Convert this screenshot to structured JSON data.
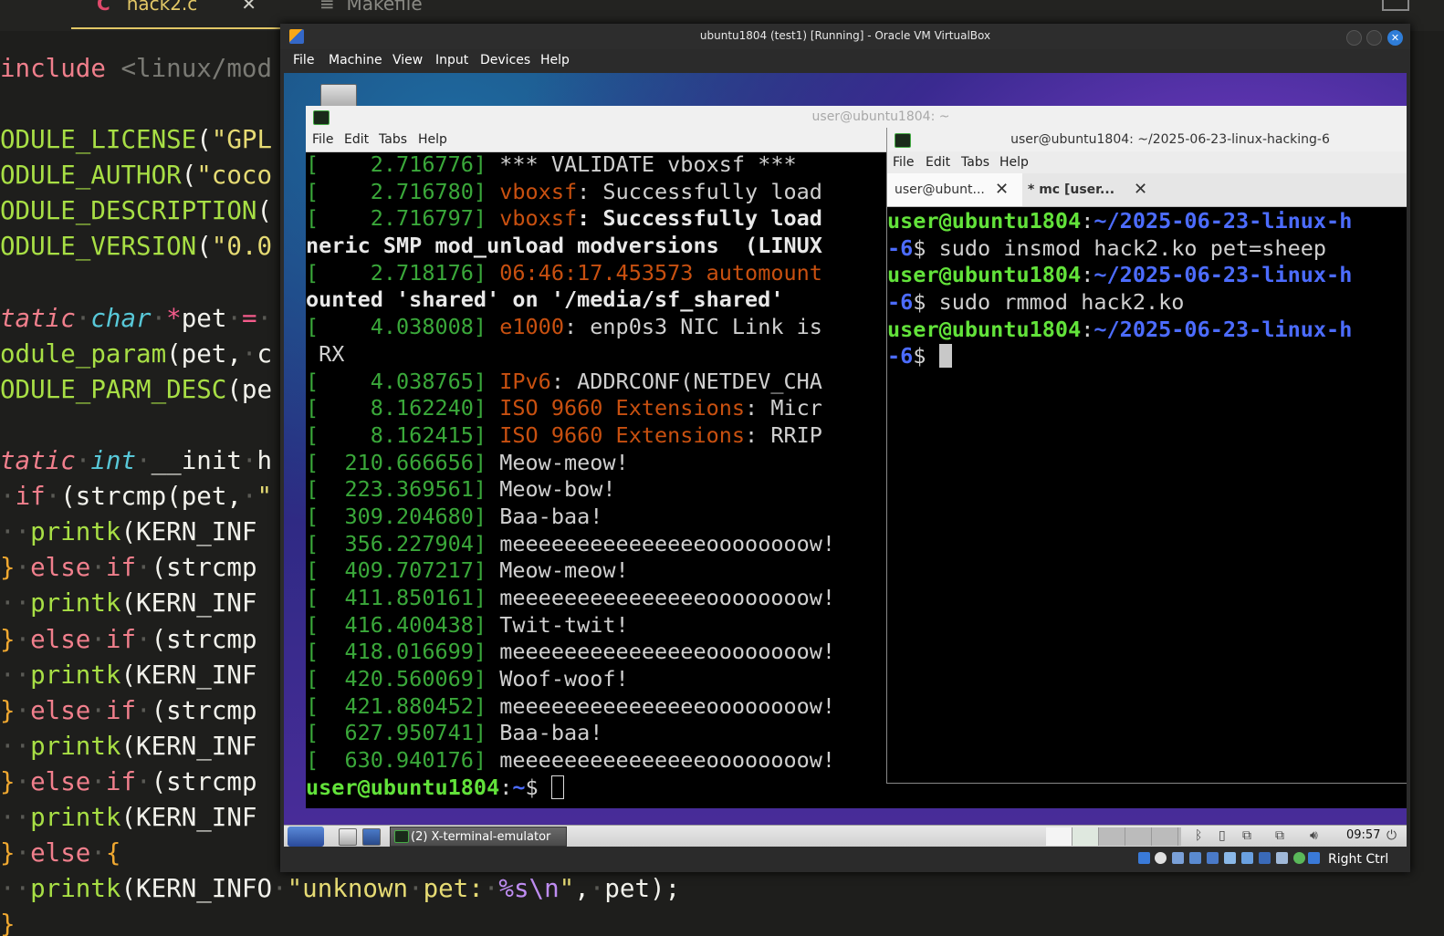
{
  "editor": {
    "tabs": [
      {
        "label": "hack2.c",
        "icon": "c-file-icon"
      },
      {
        "label": "Makefile",
        "icon": "menu-lines-icon"
      }
    ],
    "lines": [
      [
        {
          "c": "k",
          "t": "include"
        },
        {
          "c": "dim",
          "t": " <linux/mod"
        }
      ],
      [],
      [
        {
          "c": "mac",
          "t": "ODULE_LICENSE"
        },
        {
          "c": "vt",
          "t": "("
        },
        {
          "c": "st",
          "t": "\"GPL"
        }
      ],
      [
        {
          "c": "mac",
          "t": "ODULE_AUTHOR"
        },
        {
          "c": "vt",
          "t": "("
        },
        {
          "c": "st",
          "t": "\"coco"
        }
      ],
      [
        {
          "c": "mac",
          "t": "ODULE_DESCRIPTION"
        },
        {
          "c": "vt",
          "t": "("
        }
      ],
      [
        {
          "c": "mac",
          "t": "ODULE_VERSION"
        },
        {
          "c": "vt",
          "t": "("
        },
        {
          "c": "st",
          "t": "\"0.0"
        }
      ],
      [],
      [
        {
          "c": "ks",
          "t": "tatic"
        },
        {
          "c": "dt",
          "t": "·"
        },
        {
          "c": "ty",
          "t": "char"
        },
        {
          "c": "dt",
          "t": "·"
        },
        {
          "c": "op",
          "t": "*"
        },
        {
          "c": "vt",
          "t": "pet"
        },
        {
          "c": "dt",
          "t": "·"
        },
        {
          "c": "op",
          "t": "="
        },
        {
          "c": "dt",
          "t": "·"
        }
      ],
      [
        {
          "c": "mac",
          "t": "odule_param"
        },
        {
          "c": "vt",
          "t": "(pet,"
        },
        {
          "c": "dt",
          "t": "·"
        },
        {
          "c": "vt",
          "t": "c"
        }
      ],
      [
        {
          "c": "mac",
          "t": "ODULE_PARM_DESC"
        },
        {
          "c": "vt",
          "t": "(pe"
        }
      ],
      [],
      [
        {
          "c": "ks",
          "t": "tatic"
        },
        {
          "c": "dt",
          "t": "·"
        },
        {
          "c": "ty",
          "t": "int"
        },
        {
          "c": "dt",
          "t": "·"
        },
        {
          "c": "vt",
          "t": "__init"
        },
        {
          "c": "dt",
          "t": "·"
        },
        {
          "c": "vt",
          "t": "h"
        }
      ],
      [
        {
          "c": "dt",
          "t": "·"
        },
        {
          "c": "k",
          "t": "if"
        },
        {
          "c": "dt",
          "t": "·"
        },
        {
          "c": "vt",
          "t": "(strcmp(pet,"
        },
        {
          "c": "dt",
          "t": "·"
        },
        {
          "c": "st",
          "t": "\""
        }
      ],
      [
        {
          "c": "dt",
          "t": "··"
        },
        {
          "c": "mac",
          "t": "printk"
        },
        {
          "c": "vt",
          "t": "(KERN_INF"
        }
      ],
      [
        {
          "c": "br",
          "t": "}"
        },
        {
          "c": "dt",
          "t": "·"
        },
        {
          "c": "k",
          "t": "else"
        },
        {
          "c": "dt",
          "t": "·"
        },
        {
          "c": "k",
          "t": "if"
        },
        {
          "c": "dt",
          "t": "·"
        },
        {
          "c": "vt",
          "t": "(strcmp"
        }
      ],
      [
        {
          "c": "dt",
          "t": "··"
        },
        {
          "c": "mac",
          "t": "printk"
        },
        {
          "c": "vt",
          "t": "(KERN_INF"
        }
      ],
      [
        {
          "c": "br",
          "t": "}"
        },
        {
          "c": "dt",
          "t": "·"
        },
        {
          "c": "k",
          "t": "else"
        },
        {
          "c": "dt",
          "t": "·"
        },
        {
          "c": "k",
          "t": "if"
        },
        {
          "c": "dt",
          "t": "·"
        },
        {
          "c": "vt",
          "t": "(strcmp"
        }
      ],
      [
        {
          "c": "dt",
          "t": "··"
        },
        {
          "c": "mac",
          "t": "printk"
        },
        {
          "c": "vt",
          "t": "(KERN_INF"
        }
      ],
      [
        {
          "c": "br",
          "t": "}"
        },
        {
          "c": "dt",
          "t": "·"
        },
        {
          "c": "k",
          "t": "else"
        },
        {
          "c": "dt",
          "t": "·"
        },
        {
          "c": "k",
          "t": "if"
        },
        {
          "c": "dt",
          "t": "·"
        },
        {
          "c": "vt",
          "t": "(strcmp"
        }
      ],
      [
        {
          "c": "dt",
          "t": "··"
        },
        {
          "c": "mac",
          "t": "printk"
        },
        {
          "c": "vt",
          "t": "(KERN_INF"
        }
      ],
      [
        {
          "c": "br",
          "t": "}"
        },
        {
          "c": "dt",
          "t": "·"
        },
        {
          "c": "k",
          "t": "else"
        },
        {
          "c": "dt",
          "t": "·"
        },
        {
          "c": "k",
          "t": "if"
        },
        {
          "c": "dt",
          "t": "·"
        },
        {
          "c": "vt",
          "t": "(strcmp"
        }
      ],
      [
        {
          "c": "dt",
          "t": "··"
        },
        {
          "c": "mac",
          "t": "printk"
        },
        {
          "c": "vt",
          "t": "(KERN_INF"
        }
      ],
      [
        {
          "c": "br",
          "t": "}"
        },
        {
          "c": "dt",
          "t": "·"
        },
        {
          "c": "k",
          "t": "else"
        },
        {
          "c": "dt",
          "t": "·"
        },
        {
          "c": "br",
          "t": "{"
        }
      ],
      [
        {
          "c": "dt",
          "t": "··"
        },
        {
          "c": "mac",
          "t": "printk"
        },
        {
          "c": "vt",
          "t": "(KERN_INFO"
        },
        {
          "c": "dt",
          "t": "·"
        },
        {
          "c": "st",
          "t": "\"unknown"
        },
        {
          "c": "dt",
          "t": "·"
        },
        {
          "c": "st",
          "t": "pet:"
        },
        {
          "c": "dt",
          "t": "·"
        },
        {
          "c": "sp",
          "t": "%s\\n"
        },
        {
          "c": "st",
          "t": "\""
        },
        {
          "c": "vt",
          "t": ","
        },
        {
          "c": "dt",
          "t": "·"
        },
        {
          "c": "vt",
          "t": "pet);"
        }
      ],
      [
        {
          "c": "br",
          "t": "}"
        }
      ]
    ]
  },
  "vbox": {
    "title": "ubuntu1804 (test1) [Running] - Oracle VM VirtualBox",
    "menu": [
      "File",
      "Machine",
      "View",
      "Input",
      "Devices",
      "Help"
    ],
    "host_key": "Right Ctrl"
  },
  "term1": {
    "title": "user@ubuntu1804: ~",
    "menu": [
      "File",
      "Edit",
      "Tabs",
      "Help"
    ],
    "lines": [
      [
        {
          "c": "g",
          "t": "[    2.716776]"
        },
        {
          "c": "",
          "t": " *** VALIDATE vboxsf ***"
        }
      ],
      [
        {
          "c": "g",
          "t": "[    2.716780]"
        },
        {
          "c": "o",
          "t": " vboxsf"
        },
        {
          "c": "",
          "t": ": Successfully load"
        }
      ],
      [
        {
          "c": "g",
          "t": "[    2.716797]"
        },
        {
          "c": "o",
          "t": " vboxsf"
        },
        {
          "c": "b",
          "t": ": Successfully load"
        }
      ],
      [
        {
          "c": "b",
          "t": "neric SMP mod_unload modversions  (LINUX"
        }
      ],
      [
        {
          "c": "g",
          "t": "[    2.718176]"
        },
        {
          "c": "o",
          "t": " 06:46:17.453573 automount"
        }
      ],
      [
        {
          "c": "b",
          "t": "ounted 'shared' on '/media/sf_shared'"
        }
      ],
      [
        {
          "c": "g",
          "t": "[    4.038008]"
        },
        {
          "c": "o",
          "t": " e1000"
        },
        {
          "c": "",
          "t": ": enp0s3 NIC Link is"
        }
      ],
      [
        {
          "c": "",
          "t": " RX"
        }
      ],
      [
        {
          "c": "g",
          "t": "[    4.038765]"
        },
        {
          "c": "o",
          "t": " IPv6"
        },
        {
          "c": "",
          "t": ": ADDRCONF(NETDEV_CHA"
        }
      ],
      [
        {
          "c": "g",
          "t": "[    8.162240]"
        },
        {
          "c": "o",
          "t": " ISO 9660 Extensions"
        },
        {
          "c": "",
          "t": ": Micr"
        }
      ],
      [
        {
          "c": "g",
          "t": "[    8.162415]"
        },
        {
          "c": "o",
          "t": " ISO 9660 Extensions"
        },
        {
          "c": "",
          "t": ": RRIP"
        }
      ],
      [
        {
          "c": "g",
          "t": "[  210.666656]"
        },
        {
          "c": "",
          "t": " Meow-meow!"
        }
      ],
      [
        {
          "c": "g",
          "t": "[  223.369561]"
        },
        {
          "c": "",
          "t": " Meow-bow!"
        }
      ],
      [
        {
          "c": "g",
          "t": "[  309.204680]"
        },
        {
          "c": "",
          "t": " Baa-baa!"
        }
      ],
      [
        {
          "c": "g",
          "t": "[  356.227904]"
        },
        {
          "c": "",
          "t": " meeeeeeeeeeeeeeeoooooooow!"
        }
      ],
      [
        {
          "c": "g",
          "t": "[  409.707217]"
        },
        {
          "c": "",
          "t": " Meow-meow!"
        }
      ],
      [
        {
          "c": "g",
          "t": "[  411.850161]"
        },
        {
          "c": "",
          "t": " meeeeeeeeeeeeeeeoooooooow!"
        }
      ],
      [
        {
          "c": "g",
          "t": "[  416.400438]"
        },
        {
          "c": "",
          "t": " Twit-twit!"
        }
      ],
      [
        {
          "c": "g",
          "t": "[  418.016699]"
        },
        {
          "c": "",
          "t": " meeeeeeeeeeeeeeeoooooooow!"
        }
      ],
      [
        {
          "c": "g",
          "t": "[  420.560069]"
        },
        {
          "c": "",
          "t": " Woof-woof!"
        }
      ],
      [
        {
          "c": "g",
          "t": "[  421.880452]"
        },
        {
          "c": "",
          "t": " meeeeeeeeeeeeeeeoooooooow!"
        }
      ],
      [
        {
          "c": "g",
          "t": "[  627.950741]"
        },
        {
          "c": "",
          "t": " Baa-baa!"
        }
      ],
      [
        {
          "c": "g",
          "t": "[  630.940176]"
        },
        {
          "c": "",
          "t": " meeeeeeeeeeeeeeeoooooooow!"
        }
      ],
      [
        {
          "c": "lg",
          "t": "user@ubuntu1804"
        },
        {
          "c": "",
          "t": ":"
        },
        {
          "c": "lb",
          "t": "~"
        },
        {
          "c": "",
          "t": "$ "
        },
        {
          "c": "cur-o",
          "t": ""
        }
      ]
    ]
  },
  "term2": {
    "title": "user@ubuntu1804: ~/2025-06-23-linux-hacking-6",
    "menu": [
      "File",
      "Edit",
      "Tabs",
      "Help"
    ],
    "tabs": [
      {
        "label": "user@ubunt...",
        "close": "✕"
      },
      {
        "label": "* mc [user...",
        "close": "✕"
      }
    ],
    "lines": [
      [
        {
          "c": "lg",
          "t": "user@ubuntu1804"
        },
        {
          "c": "",
          "t": ":"
        },
        {
          "c": "lb",
          "t": "~/2025-06-23-linux-h"
        }
      ],
      [
        {
          "c": "lb",
          "t": "-6"
        },
        {
          "c": "",
          "t": "$ sudo insmod hack2.ko pet=sheep"
        }
      ],
      [
        {
          "c": "lg",
          "t": "user@ubuntu1804"
        },
        {
          "c": "",
          "t": ":"
        },
        {
          "c": "lb",
          "t": "~/2025-06-23-linux-h"
        }
      ],
      [
        {
          "c": "lb",
          "t": "-6"
        },
        {
          "c": "",
          "t": "$ sudo rmmod hack2.ko"
        }
      ],
      [
        {
          "c": "lg",
          "t": "user@ubuntu1804"
        },
        {
          "c": "",
          "t": ":"
        },
        {
          "c": "lb",
          "t": "~/2025-06-23-linux-h"
        }
      ],
      [
        {
          "c": "lb",
          "t": "-6"
        },
        {
          "c": "",
          "t": "$ "
        },
        {
          "c": "cur-f",
          "t": ""
        }
      ]
    ]
  },
  "taskbar": {
    "task_label": "(2) X-terminal-emulator",
    "clock": "09:57"
  },
  "colors": {
    "prompt_green": "#62e23a",
    "path_blue": "#4c6cff",
    "timestamp_green": "#3aa83a",
    "subsystem_orange": "#c85010",
    "editor_bg": "#1e1e1c"
  }
}
